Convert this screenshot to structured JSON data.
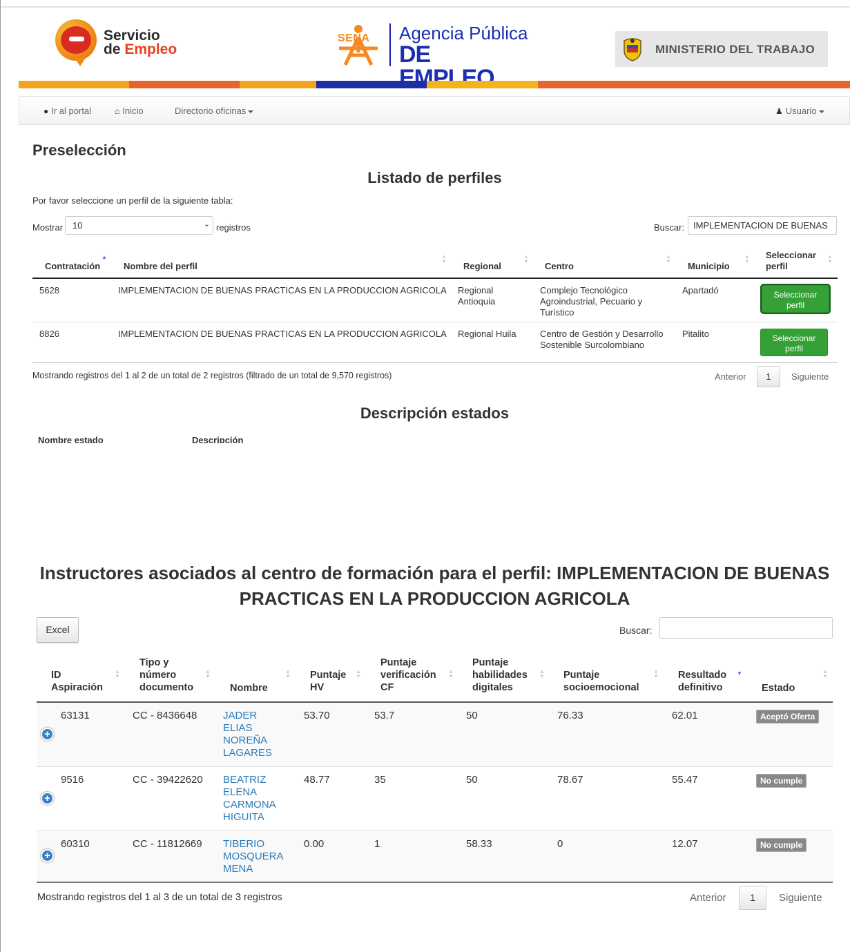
{
  "header": {
    "servicio_line1": "Servicio",
    "servicio_de": "de ",
    "servicio_empleo": "Empleo",
    "sena_word": "SENA",
    "agencia_line1": "Agencia Pública",
    "agencia_line2": "DE EMPLEO",
    "ministerio": "MINISTERIO DEL TRABAJO",
    "stripe_colors": [
      "#f4a31b",
      "#e8642a",
      "#f4a31b",
      "#1d2fa3",
      "#f4b21b",
      "#e8642a"
    ]
  },
  "nav": {
    "portal": "Ir al portal",
    "inicio": "Inicio",
    "directorio": "Directorio oficinas",
    "usuario": "Usuario"
  },
  "page": {
    "title": "Preselección",
    "listado_title": "Listado de perfiles",
    "instruction": "Por favor seleccione un perfil de la siguiente tabla:",
    "mostrar_label": "Mostrar",
    "mostrar_value": "10",
    "registros_label": "registros",
    "buscar_label": "Buscar:",
    "buscar_value": "IMPLEMENTACION DE BUENAS"
  },
  "perfiles": {
    "headers": {
      "contratacion": "Contratación",
      "nombre": "Nombre del perfil",
      "regional": "Regional",
      "centro": "Centro",
      "municipio": "Municipio",
      "seleccionar": "Seleccionar perfil"
    },
    "rows": [
      {
        "contratacion": "5628",
        "nombre": "IMPLEMENTACION DE BUENAS PRACTICAS EN LA PRODUCCION AGRICOLA",
        "regional": "Regional Antioquia",
        "centro": "Complejo Tecnológico Agroindustrial, Pecuario y Turístico",
        "municipio": "Apartadó",
        "button": "Seleccionar perfil"
      },
      {
        "contratacion": "8826",
        "nombre": "IMPLEMENTACION DE BUENAS PRACTICAS EN LA PRODUCCION AGRICOLA",
        "regional": "Regional Huila",
        "centro": "Centro de Gestión y Desarrollo Sostenible Surcolombiano",
        "municipio": "Pitalito",
        "button": "Seleccionar perfil"
      }
    ],
    "info": "Mostrando registros del 1 al 2 de un total de 2 registros (filtrado de un total de 9,570 registros)",
    "pagination": {
      "prev": "Anterior",
      "current": "1",
      "next": "Siguiente"
    }
  },
  "estados": {
    "title": "Descripción estados",
    "col_nombre": "Nombre estado",
    "col_descripcion": "Descripción"
  },
  "instructores": {
    "title": "Instructores asociados al centro de formación para el perfil: IMPLEMENTACION DE BUENAS PRACTICAS EN LA PRODUCCION AGRICOLA",
    "excel_button": "Excel",
    "buscar_label": "Buscar:",
    "buscar_value": "",
    "headers": {
      "id": "ID Aspiración",
      "tipo": "Tipo y número documento",
      "nombre": "Nombre",
      "hv": "Puntaje HV",
      "cf": "Puntaje verificación CF",
      "digitales": "Puntaje habilidades digitales",
      "socio": "Puntaje socioemocional",
      "resultado": "Resultado definitivo",
      "estado": "Estado"
    },
    "rows": [
      {
        "id": "63131",
        "documento": "CC - 8436648",
        "nombre": "JADER ELIAS NOREÑA LAGARES",
        "hv": "53.70",
        "cf": "53.7",
        "digitales": "50",
        "socio": "76.33",
        "resultado": "62.01",
        "estado": "Aceptó Oferta"
      },
      {
        "id": "9516",
        "documento": "CC - 39422620",
        "nombre": "BEATRIZ ELENA CARMONA HIGUITA",
        "hv": "48.77",
        "cf": "35",
        "digitales": "50",
        "socio": "78.67",
        "resultado": "55.47",
        "estado": "No cumple"
      },
      {
        "id": "60310",
        "documento": "CC - 11812669",
        "nombre": "TIBERIO MOSQUERA MENA",
        "hv": "0.00",
        "cf": "1",
        "digitales": "58.33",
        "socio": "0",
        "resultado": "12.07",
        "estado": "No cumple"
      }
    ],
    "info": "Mostrando registros del 1 al 3 de un total de 3 registros",
    "pagination": {
      "prev": "Anterior",
      "current": "1",
      "next": "Siguiente"
    }
  }
}
